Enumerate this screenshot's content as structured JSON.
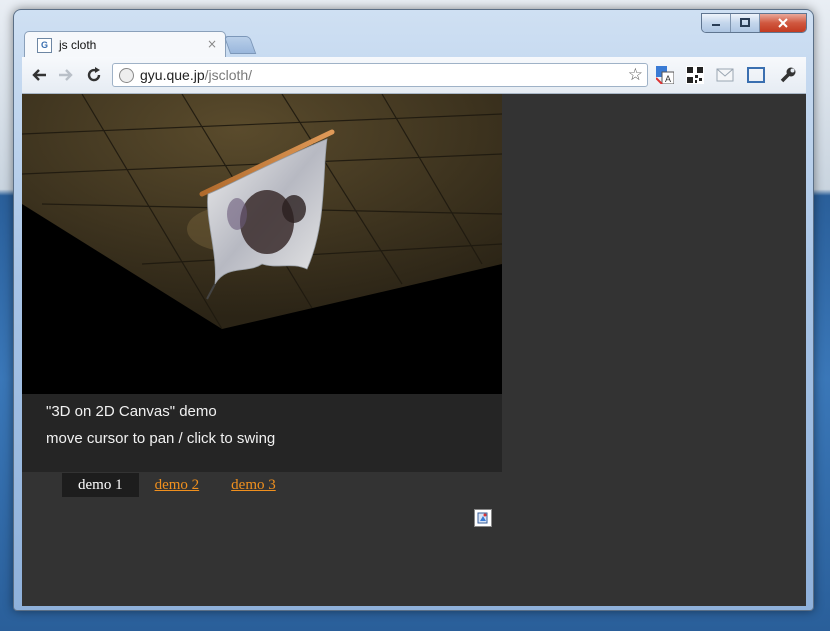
{
  "window": {
    "controls": {
      "minimize": "minimize-icon",
      "maximize": "maximize-icon",
      "close": "close-icon"
    }
  },
  "tab": {
    "title": "js cloth",
    "favicon": "G",
    "close": "×"
  },
  "toolbar": {
    "url_host": "gyu.que.jp",
    "url_path": "/jscloth/",
    "icons": [
      "back-arrow-icon",
      "forward-arrow-icon",
      "reload-icon",
      "star-icon",
      "translate-icon",
      "qr-code-icon",
      "mail-icon",
      "fullscreen-icon",
      "wrench-icon"
    ]
  },
  "page": {
    "caption_line1": "\"3D on 2D Canvas\" demo",
    "caption_line2": "move cursor to pan / click to swing",
    "demos": [
      {
        "label": "demo 1",
        "active": true
      },
      {
        "label": "demo 2",
        "active": false
      },
      {
        "label": "demo 3",
        "active": false
      }
    ]
  },
  "colors": {
    "page_bg": "#333333",
    "caption_bg": "#252525",
    "link": "#f0901e"
  }
}
